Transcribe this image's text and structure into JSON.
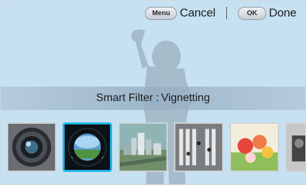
{
  "topbar": {
    "menu_key": "Menu",
    "cancel_label": "Cancel",
    "ok_key": "OK",
    "done_label": "Done"
  },
  "banner": {
    "prefix": "Smart Filter :",
    "filter_name": "Vignetting"
  },
  "filters": [
    {
      "name": "lens-thumbnail",
      "selected": false
    },
    {
      "name": "vignetting-thumbnail",
      "selected": true
    },
    {
      "name": "miniature-thumbnail",
      "selected": false
    },
    {
      "name": "crosswalk-thumbnail",
      "selected": false
    },
    {
      "name": "flowers-thumbnail",
      "selected": false
    },
    {
      "name": "monochrome-thumbnail",
      "selected": false
    }
  ],
  "colors": {
    "background": "#c6e1f1",
    "selection": "#1eb4e6",
    "silhouette": "#a7bccb"
  }
}
